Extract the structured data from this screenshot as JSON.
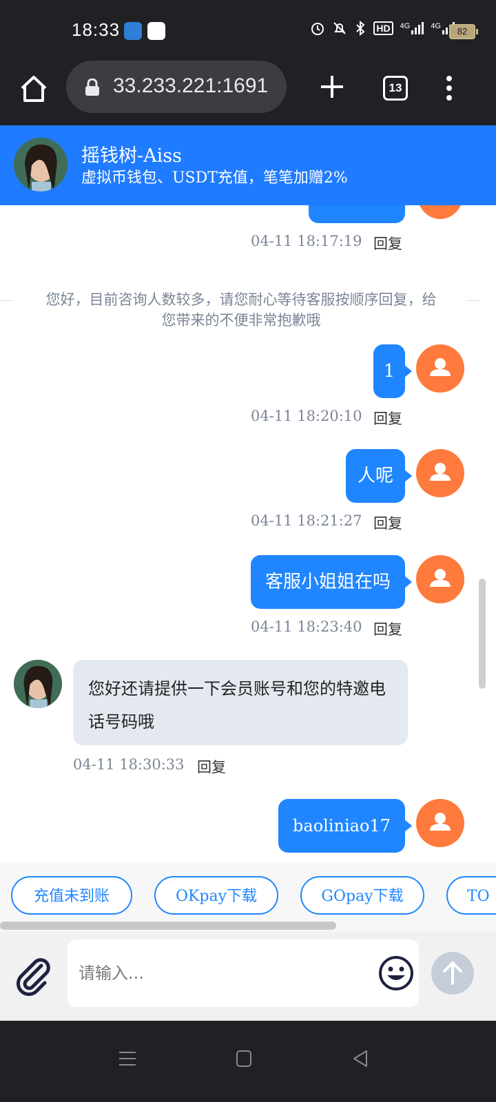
{
  "status": {
    "time": "18:33",
    "battery": "82",
    "network_1": "4G",
    "network_2": "4G",
    "hd": "HD"
  },
  "browser": {
    "url": "33.233.221:1691",
    "tab_count": "13"
  },
  "header": {
    "title": "摇钱树-Aiss",
    "subtitle": "虚拟币钱包、USDT充值，笔笔加赠2%"
  },
  "messages": {
    "m0": {
      "time": "04-11 18:17:19",
      "reply": "回复"
    },
    "notice": "您好，目前咨询人数较多，请您耐心等待客服按顺序回复，给您带来的不便非常抱歉哦",
    "m1": {
      "text": "1",
      "time": "04-11 18:20:10",
      "reply": "回复"
    },
    "m2": {
      "text": "人呢",
      "time": "04-11 18:21:27",
      "reply": "回复"
    },
    "m3": {
      "text": "客服小姐姐在吗",
      "time": "04-11 18:23:40",
      "reply": "回复"
    },
    "m4": {
      "text": "您好还请提供一下会员账号和您的特邀电话号码哦",
      "time": "04-11 18:30:33",
      "reply": "回复"
    },
    "m5": {
      "text": "baoliniao17"
    }
  },
  "quick_replies": [
    "充值未到账",
    "OKpay下载",
    "GOpay下载",
    "TO"
  ],
  "input": {
    "placeholder": "请输入..."
  },
  "colors": {
    "accent": "#1f86ff",
    "header_bg": "#1f7bff",
    "user_avatar": "#ff7a3d",
    "incoming_bubble": "#e4e9f1"
  }
}
